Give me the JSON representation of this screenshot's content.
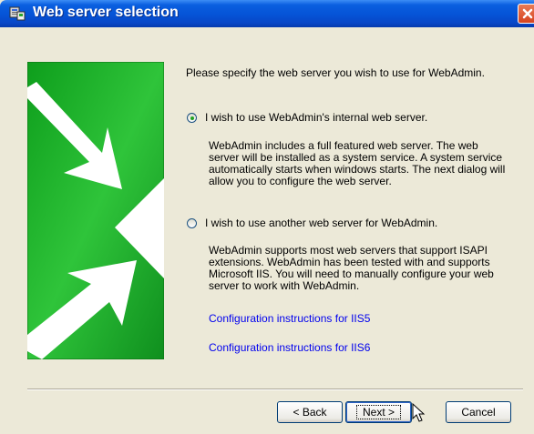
{
  "window": {
    "title": "Web server selection"
  },
  "intro": "Please specify the web server you wish to use for WebAdmin.",
  "option1": {
    "label": "I wish to use WebAdmin's internal web server.",
    "selected": true,
    "desc_lines": [
      "WebAdmin includes a full featured web server.  The web",
      "server will be installed as a system service.  A system service",
      "automatically starts when windows starts.  The next dialog will",
      "allow you to configure the web server."
    ]
  },
  "option2": {
    "label": "I wish to use another web server for WebAdmin.",
    "selected": false,
    "desc_lines": [
      "WebAdmin supports most web servers that support ISAPI",
      "extensions. WebAdmin has been tested with and supports",
      "Microsoft IIS.  You will need to manually configure your web",
      "server to work with WebAdmin."
    ]
  },
  "links": {
    "iis5": "Configuration instructions for IIS5",
    "iis6": "Configuration instructions for IIS6"
  },
  "buttons": {
    "back": "< Back",
    "next": "Next >",
    "cancel": "Cancel"
  },
  "colors": {
    "link": "#0000ee",
    "banner_green": "#2fbf2f",
    "titlebar": "#0553d6"
  }
}
